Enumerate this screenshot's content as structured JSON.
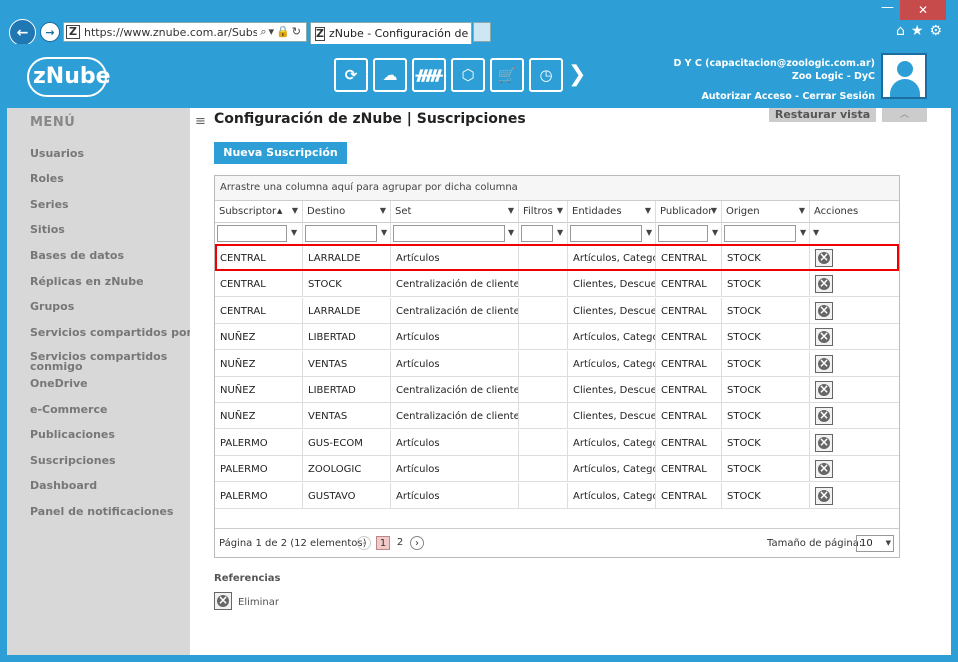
{
  "browser": {
    "url": "https://www.znube.com.ar/Subscription",
    "tab_title": "zNube - Configuración de z...",
    "tab_close": "×",
    "window_controls": {
      "min": "—",
      "max": "☐",
      "close": "✕"
    },
    "tool_icons": "⌂★⚙"
  },
  "header": {
    "brand": "zNube",
    "user_line1": "D Y C (capacitacion@zoologic.com.ar)",
    "user_line2": "Zoo Logic - DyC",
    "authorize_link": "Autorizar Acceso",
    "separator": "-",
    "logout_link": "Cerrar Sesión",
    "modules": [
      {
        "icon": "users-cycle-icon",
        "glyph": "⟳"
      },
      {
        "icon": "cloud-gear-icon",
        "glyph": "☁"
      },
      {
        "icon": "forms-icon",
        "glyph": "ᚏ"
      },
      {
        "icon": "box-icon",
        "glyph": "⬡"
      },
      {
        "icon": "cart-icon",
        "glyph": "🛒"
      },
      {
        "icon": "clock-icon",
        "glyph": "◷"
      }
    ],
    "modules_arrow": "❯"
  },
  "sidebar": {
    "title": "MENÚ",
    "items": [
      {
        "label": "Usuarios",
        "name": "usuarios"
      },
      {
        "label": "Roles",
        "name": "roles"
      },
      {
        "label": "Series",
        "name": "series"
      },
      {
        "label": "Sitios",
        "name": "sitios"
      },
      {
        "label": "Bases de datos",
        "name": "bases-de-datos"
      },
      {
        "label": "Réplicas en zNube",
        "name": "replicas"
      },
      {
        "label": "Grupos",
        "name": "grupos"
      },
      {
        "label": "Servicios compartidos por mi",
        "name": "servicios-compartidos-por-mi"
      },
      {
        "label": "Servicios compartidos conmigo",
        "name": "servicios-compartidos-conmigo"
      },
      {
        "label": "OneDrive",
        "name": "onedrive"
      },
      {
        "label": "e-Commerce",
        "name": "ecommerce"
      },
      {
        "label": "Publicaciones",
        "name": "publicaciones"
      },
      {
        "label": "Suscripciones",
        "name": "suscripciones"
      },
      {
        "label": "Dashboard",
        "name": "dashboard"
      },
      {
        "label": "Panel de notificaciones",
        "name": "panel-notificaciones"
      }
    ]
  },
  "main": {
    "menu_toggle": "≡",
    "title": "Configuración de zNube | Suscripciones",
    "restore_view": "Restaurar vista",
    "collapse": "︿",
    "new_button": "Nueva Suscripción"
  },
  "grid": {
    "group_hint": "Arrastre una columna aquí para agrupar por dicha columna",
    "columns": [
      {
        "label": "Subscriptor",
        "sort": "▲",
        "filter": "▼"
      },
      {
        "label": "Destino",
        "filter": "▼"
      },
      {
        "label": "Set",
        "filter": "▼"
      },
      {
        "label": "Filtros",
        "filter": "▼"
      },
      {
        "label": "Entidades",
        "filter": "▼"
      },
      {
        "label": "Publicador",
        "filter": "▼"
      },
      {
        "label": "Origen",
        "filter": "▼"
      },
      {
        "label": "Acciones"
      }
    ],
    "rows": [
      {
        "sub": "CENTRAL",
        "dest": "LARRALDE",
        "set": "Artículos",
        "filt": "",
        "ent": "Artículos, Categorías",
        "pub": "CENTRAL",
        "orig": "STOCK"
      },
      {
        "sub": "CENTRAL",
        "dest": "STOCK",
        "set": "Centralización de clientes",
        "filt": "",
        "ent": "Clientes, Descuentos",
        "pub": "CENTRAL",
        "orig": "STOCK"
      },
      {
        "sub": "CENTRAL",
        "dest": "LARRALDE",
        "set": "Centralización de clientes",
        "filt": "",
        "ent": "Clientes, Descuentos",
        "pub": "CENTRAL",
        "orig": "STOCK"
      },
      {
        "sub": "NUÑEZ",
        "dest": "LIBERTAD",
        "set": "Artículos",
        "filt": "",
        "ent": "Artículos, Categorías",
        "pub": "CENTRAL",
        "orig": "STOCK"
      },
      {
        "sub": "NUÑEZ",
        "dest": "VENTAS",
        "set": "Artículos",
        "filt": "",
        "ent": "Artículos, Categorías",
        "pub": "CENTRAL",
        "orig": "STOCK"
      },
      {
        "sub": "NUÑEZ",
        "dest": "LIBERTAD",
        "set": "Centralización de clientes",
        "filt": "",
        "ent": "Clientes, Descuentos",
        "pub": "CENTRAL",
        "orig": "STOCK"
      },
      {
        "sub": "NUÑEZ",
        "dest": "VENTAS",
        "set": "Centralización de clientes",
        "filt": "",
        "ent": "Clientes, Descuentos",
        "pub": "CENTRAL",
        "orig": "STOCK"
      },
      {
        "sub": "PALERMO",
        "dest": "GUS-ECOM",
        "set": "Artículos",
        "filt": "",
        "ent": "Artículos, Categorías",
        "pub": "CENTRAL",
        "orig": "STOCK"
      },
      {
        "sub": "PALERMO",
        "dest": "ZOOLOGIC",
        "set": "Artículos",
        "filt": "",
        "ent": "Artículos, Categorías",
        "pub": "CENTRAL",
        "orig": "STOCK"
      },
      {
        "sub": "PALERMO",
        "dest": "GUSTAVO",
        "set": "Artículos",
        "filt": "",
        "ent": "Artículos, Categorías",
        "pub": "CENTRAL",
        "orig": "STOCK"
      }
    ],
    "pager": {
      "info": "Página 1 de 2 (12 elementos)",
      "prev": "‹",
      "page1": "1",
      "page2": "2",
      "next": "›",
      "page_size_label": "Tamaño de página:",
      "page_size": "10",
      "page_size_arrow": "▼"
    }
  },
  "references": {
    "title": "Referencias",
    "delete_label": "Eliminar"
  }
}
